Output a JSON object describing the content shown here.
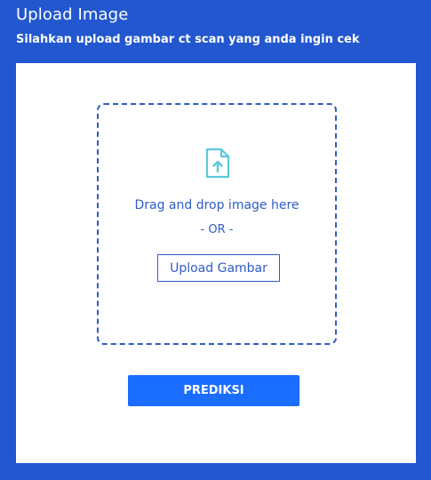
{
  "header": {
    "title": "Upload Image",
    "subtitle": "Silahkan upload gambar ct scan yang anda ingin cek"
  },
  "dropzone": {
    "icon": "file-upload-icon",
    "instruction": "Drag and drop image here",
    "separator": "- OR -",
    "upload_button_label": "Upload Gambar"
  },
  "actions": {
    "predict_label": "PREDIKSI"
  },
  "colors": {
    "background": "#2257cf",
    "panel": "#ffffff",
    "accent": "#2f5cc7",
    "icon": "#5bc9d9",
    "primary_button": "#1a6dff"
  }
}
